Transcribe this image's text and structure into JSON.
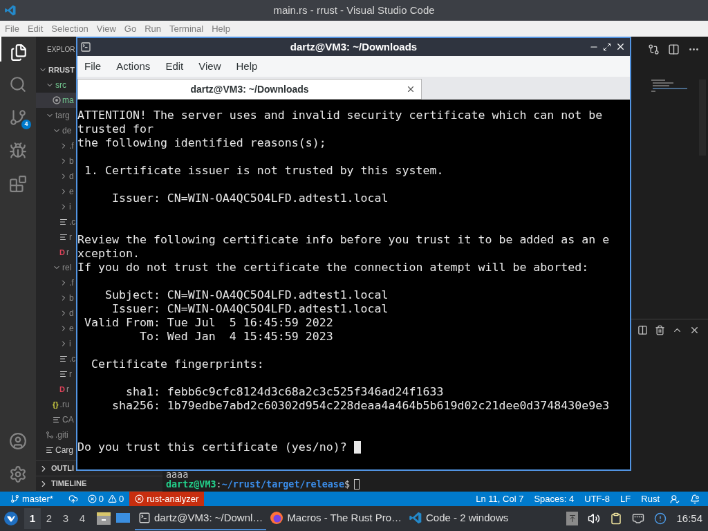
{
  "window": {
    "title": "main.rs - rrust - Visual Studio Code"
  },
  "menu": [
    "File",
    "Edit",
    "Selection",
    "View",
    "Go",
    "Run",
    "Terminal",
    "Help"
  ],
  "activity_bar": {
    "source_control_badge": "4"
  },
  "sidebar": {
    "title": "EXPLOR",
    "tree": [
      {
        "label": "RRUST",
        "kind": "folder",
        "expanded": true,
        "selected": false,
        "color": "#cccccc",
        "children": [
          {
            "label": "src",
            "kind": "folder",
            "expanded": true,
            "selected": false,
            "color": "#73c991",
            "children": [
              {
                "label": "ma",
                "kind": "rust",
                "selected": true,
                "color": "#73c991"
              }
            ]
          },
          {
            "label": "targ",
            "kind": "folder",
            "expanded": true,
            "selected": false,
            "color": "#8c8c8c",
            "children": [
              {
                "label": "de",
                "kind": "folder",
                "expanded": true,
                "selected": false,
                "color": "#8c8c8c",
                "children": [
                  {
                    "label": ".f",
                    "kind": "folder",
                    "expanded": false,
                    "selected": false,
                    "color": "#8c8c8c"
                  },
                  {
                    "label": "b",
                    "kind": "folder",
                    "expanded": false,
                    "selected": false,
                    "color": "#8c8c8c"
                  },
                  {
                    "label": "d",
                    "kind": "folder",
                    "expanded": false,
                    "selected": false,
                    "color": "#8c8c8c"
                  },
                  {
                    "label": "e",
                    "kind": "folder",
                    "expanded": false,
                    "selected": false,
                    "color": "#8c8c8c"
                  },
                  {
                    "label": "i",
                    "kind": "folder",
                    "expanded": false,
                    "selected": false,
                    "color": "#8c8c8c"
                  },
                  {
                    "label": ".c",
                    "kind": "text",
                    "selected": false,
                    "color": "#8c8c8c"
                  },
                  {
                    "label": "r",
                    "kind": "text",
                    "selected": false,
                    "color": "#8c8c8c"
                  },
                  {
                    "label": "r",
                    "kind": "glyph",
                    "glyph": "D",
                    "selected": false,
                    "color": "#8c8c8c"
                  }
                ]
              },
              {
                "label": "rel",
                "kind": "folder",
                "expanded": true,
                "selected": false,
                "color": "#8c8c8c",
                "children": [
                  {
                    "label": ".f",
                    "kind": "folder",
                    "expanded": false,
                    "selected": false,
                    "color": "#8c8c8c"
                  },
                  {
                    "label": "b",
                    "kind": "folder",
                    "expanded": false,
                    "selected": false,
                    "color": "#8c8c8c"
                  },
                  {
                    "label": "d",
                    "kind": "folder",
                    "expanded": false,
                    "selected": false,
                    "color": "#8c8c8c"
                  },
                  {
                    "label": "e",
                    "kind": "folder",
                    "expanded": false,
                    "selected": false,
                    "color": "#8c8c8c"
                  },
                  {
                    "label": "i",
                    "kind": "folder",
                    "expanded": false,
                    "selected": false,
                    "color": "#8c8c8c"
                  },
                  {
                    "label": ".c",
                    "kind": "text",
                    "selected": false,
                    "color": "#8c8c8c"
                  },
                  {
                    "label": "r",
                    "kind": "text",
                    "selected": false,
                    "color": "#8c8c8c"
                  },
                  {
                    "label": "r",
                    "kind": "glyph",
                    "glyph": "D",
                    "selected": false,
                    "color": "#8c8c8c"
                  }
                ]
              },
              {
                "label": ".ru",
                "kind": "glyph",
                "glyph": "{}",
                "selected": false,
                "color": "#8c8c8c"
              },
              {
                "label": "CA",
                "kind": "text",
                "selected": false,
                "color": "#8c8c8c"
              }
            ]
          },
          {
            "label": ".giti",
            "kind": "git",
            "selected": false,
            "color": "#8c8c8c"
          },
          {
            "label": "Carg",
            "kind": "text",
            "selected": false,
            "color": "#cccccc"
          }
        ]
      }
    ],
    "sections": [
      {
        "label": "OUTLI",
        "expanded": false
      },
      {
        "label": "TIMELINE",
        "expanded": false
      }
    ]
  },
  "panel": {
    "lines": [
      {
        "kind": "output",
        "text": "aaaa"
      },
      {
        "kind": "prompt",
        "user": "dartz@VM3",
        "separator": ":",
        "path": "~/rrust/target/release",
        "symbol": "$"
      }
    ]
  },
  "terminal_window": {
    "title": "dartz@VM3: ~/Downloads",
    "menu": [
      "File",
      "Actions",
      "Edit",
      "View",
      "Help"
    ],
    "tabs": [
      {
        "label": "dartz@VM3: ~/Downloads",
        "selected": true
      }
    ],
    "lines": [
      {
        "kind": "text",
        "text": "ATTENTION! The server uses and invalid security certificate which can not be"
      },
      {
        "kind": "text",
        "text": "trusted for"
      },
      {
        "kind": "text",
        "text": "the following identified reasons(s);"
      },
      {
        "kind": "blank"
      },
      {
        "kind": "text",
        "text": " 1. Certificate issuer is not trusted by this system."
      },
      {
        "kind": "blank"
      },
      {
        "kind": "text",
        "text": "     Issuer: CN=WIN-OA4QC5O4LFD.adtest1.local"
      },
      {
        "kind": "blank"
      },
      {
        "kind": "blank"
      },
      {
        "kind": "text",
        "text": "Review the following certificate info before you trust it to be added as an e"
      },
      {
        "kind": "text",
        "text": "xception."
      },
      {
        "kind": "text",
        "text": "If you do not trust the certificate the connection atempt will be aborted:"
      },
      {
        "kind": "blank"
      },
      {
        "kind": "text",
        "text": "    Subject: CN=WIN-OA4QC5O4LFD.adtest1.local"
      },
      {
        "kind": "text",
        "text": "     Issuer: CN=WIN-OA4QC5O4LFD.adtest1.local"
      },
      {
        "kind": "text",
        "text": " Valid From: Tue Jul  5 16:45:59 2022"
      },
      {
        "kind": "text",
        "text": "         To: Wed Jan  4 15:45:59 2023"
      },
      {
        "kind": "blank"
      },
      {
        "kind": "text",
        "text": "  Certificate fingerprints:"
      },
      {
        "kind": "blank"
      },
      {
        "kind": "text",
        "text": "       sha1: febb6c9cfc8124d3c68a2c3c525f346ad24f1633"
      },
      {
        "kind": "text",
        "text": "     sha256: 1b79edbe7abd2c60302d954c228deaa4a464b5b619d02c21dee0d3748430e9e3"
      },
      {
        "kind": "blank"
      },
      {
        "kind": "blank"
      },
      {
        "kind": "prompt",
        "text": "Do you trust this certificate (yes/no)? "
      }
    ]
  },
  "status_bar": {
    "branch": "master*",
    "errors": "0",
    "warnings": "0",
    "error_item": "rust-analyzer",
    "right_items": [
      "Ln 11, Col 7",
      "Spaces: 4",
      "UTF-8",
      "LF",
      "Rust"
    ]
  },
  "taskbar": {
    "workspaces": [
      {
        "label": "1",
        "selected": true
      },
      {
        "label": "2",
        "selected": false
      },
      {
        "label": "3",
        "selected": false
      },
      {
        "label": "4",
        "selected": false
      }
    ],
    "tasks": [
      {
        "kind": "terminal",
        "label": "dartz@VM3: ~/Downl…",
        "selected": true
      },
      {
        "kind": "firefox",
        "label": "Macros - The Rust Pro…",
        "selected": false
      },
      {
        "kind": "vscode",
        "label": "Code - 2 windows",
        "selected": false
      }
    ],
    "clock": "16:54"
  }
}
